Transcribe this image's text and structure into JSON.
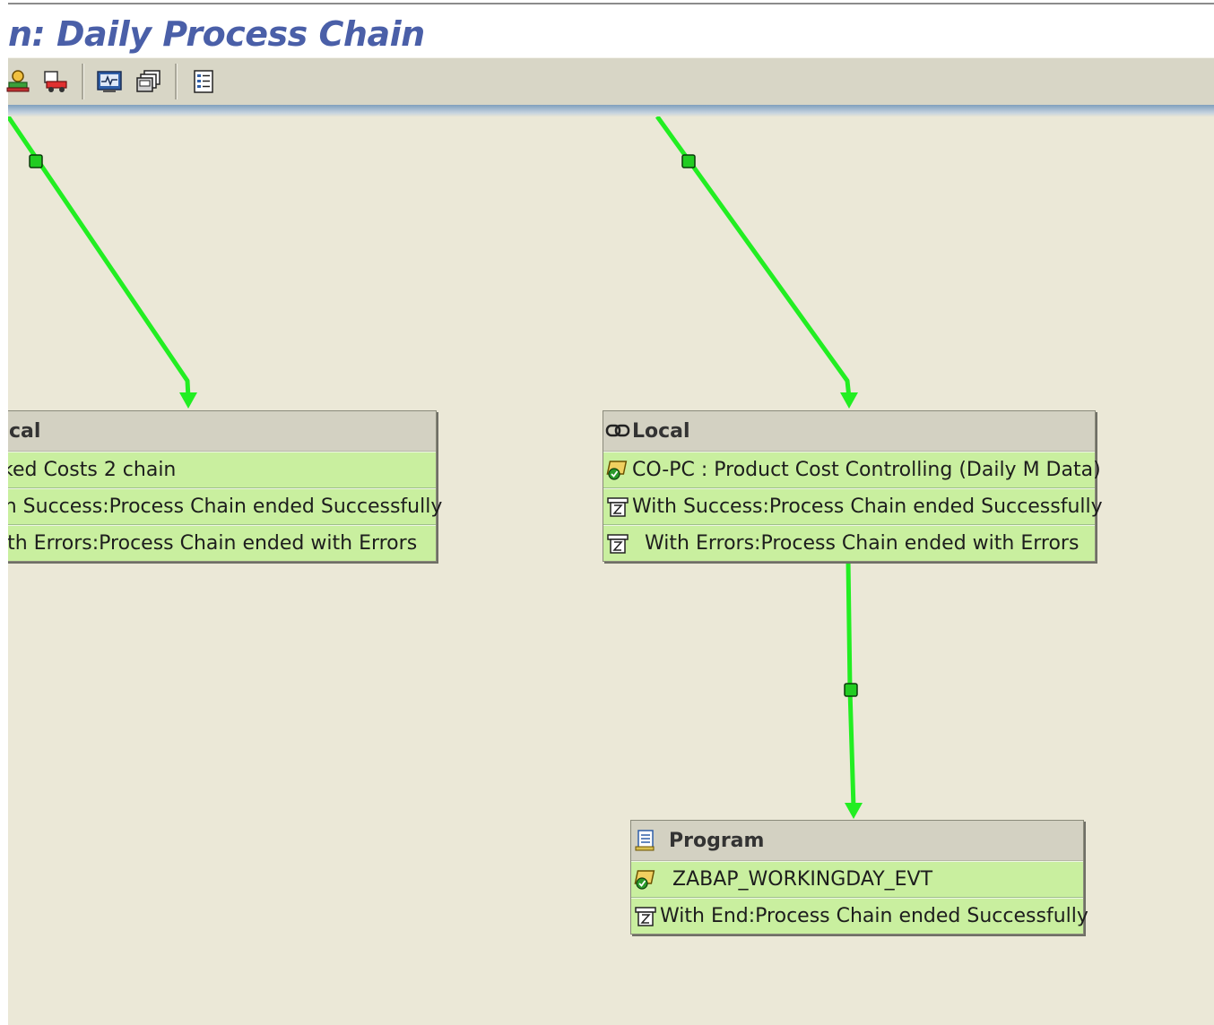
{
  "window": {
    "title": "n: Daily Process Chain"
  },
  "toolbar": {
    "buttons": [
      {
        "icon": "person-icon"
      },
      {
        "icon": "truck-icon"
      },
      {
        "icon": "monitor-icon"
      },
      {
        "icon": "windows-copy-icon"
      },
      {
        "icon": "list-icon"
      }
    ]
  },
  "colors": {
    "connector": "#22ee22",
    "node_row": "#c9ef9f",
    "node_header": "#d3d1c2",
    "canvas": "#ebe8d7",
    "title": "#4a5fa8"
  },
  "nodes": {
    "left": {
      "type_label": "cal",
      "type_icon": "link-icon",
      "rows": [
        {
          "icon": "",
          "text": "ked Costs 2 chain"
        },
        {
          "icon": "",
          "text": "ith Success:Process Chain ended Successfully"
        },
        {
          "icon": "",
          "text": "ith Errors:Process Chain ended with Errors"
        }
      ]
    },
    "right": {
      "type_label": "Local",
      "type_icon": "link-icon",
      "rows": [
        {
          "icon": "variant-icon",
          "text": "CO-PC : Product Cost Controlling (Daily M Data)"
        },
        {
          "icon": "event-icon",
          "text": "With Success:Process Chain ended Successfully"
        },
        {
          "icon": "event-icon",
          "text": "With Errors:Process Chain ended with Errors"
        }
      ]
    },
    "program": {
      "type_label": "Program",
      "type_icon": "program-doc-icon",
      "rows": [
        {
          "icon": "variant-icon",
          "text": "ZABAP_WORKINGDAY_EVT"
        },
        {
          "icon": "event-icon",
          "text": "With End:Process Chain ended Successfully"
        }
      ]
    }
  }
}
